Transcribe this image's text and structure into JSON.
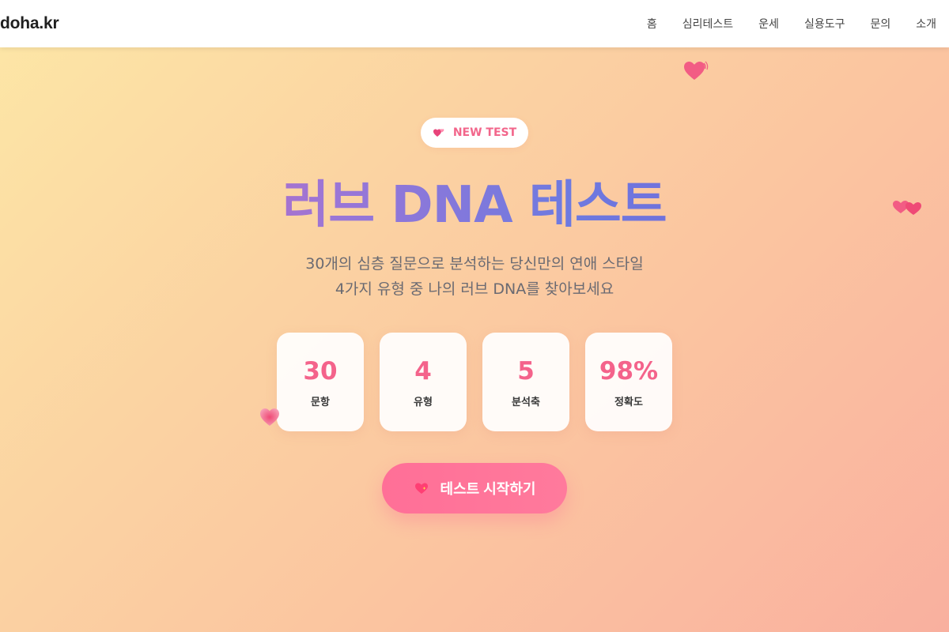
{
  "header": {
    "logo": "doha.kr",
    "nav": [
      "홈",
      "심리테스트",
      "운세",
      "실용도구",
      "문의",
      "소개"
    ]
  },
  "hero": {
    "badge": {
      "icon": "two-hearts-icon",
      "label": "NEW TEST"
    },
    "title": "러브 DNA 테스트",
    "subtitle_lines": [
      "30개의 심층 질문으로 분석하는 당신만의 연애 스타일",
      "4가지 유형 중 나의 러브 DNA를 찾아보세요"
    ],
    "stats": [
      {
        "value": "30",
        "label": "문항"
      },
      {
        "value": "4",
        "label": "유형"
      },
      {
        "value": "5",
        "label": "분석축"
      },
      {
        "value": "98%",
        "label": "정확도"
      }
    ],
    "cta": {
      "icon": "heart-with-sparkle-icon",
      "label": "테스트 시작하기"
    }
  },
  "decorations": [
    "floating-heart-icon",
    "floating-hearts-icon",
    "floating-heart-icon"
  ],
  "colors": {
    "accent": "#f4638b",
    "title_gradient": [
      "#e060a8",
      "#6d7ae0",
      "#7a5bd0"
    ],
    "background_gradient": [
      "#fde7a6",
      "#f9b09f"
    ]
  }
}
